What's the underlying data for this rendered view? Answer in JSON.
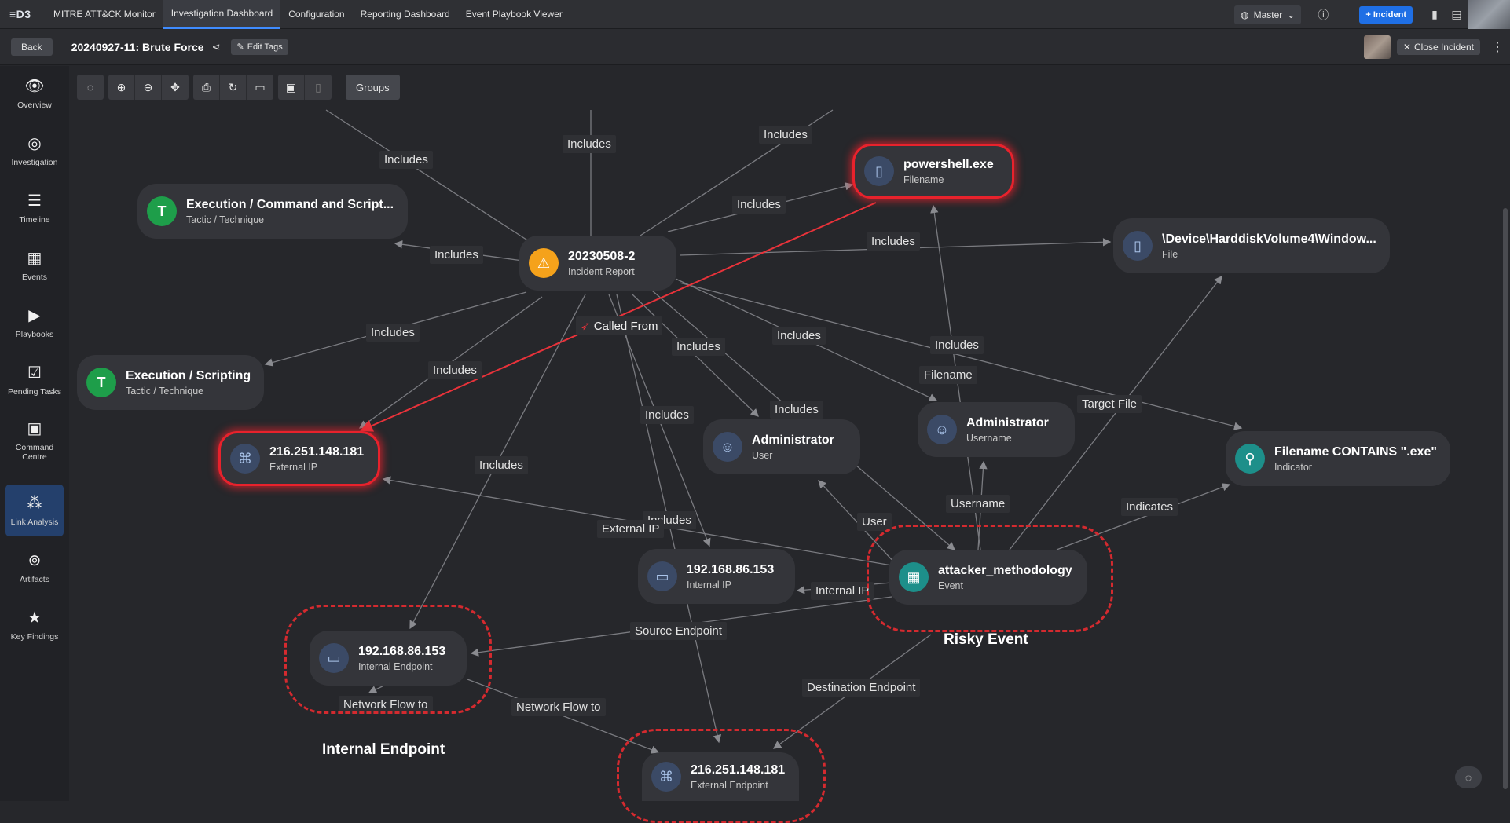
{
  "app": {
    "logo": "≡D3"
  },
  "topnav": {
    "tabs": [
      {
        "label": "MITRE ATT&CK Monitor"
      },
      {
        "label": "Investigation Dashboard"
      },
      {
        "label": "Configuration"
      },
      {
        "label": "Reporting Dashboard"
      },
      {
        "label": "Event Playbook Viewer"
      }
    ],
    "environment": "Master",
    "incident_button": "+ Incident"
  },
  "subbar": {
    "back": "Back",
    "title": "20240927-11: Brute Force",
    "edit_tags": "Edit Tags",
    "close_incident": "Close Incident"
  },
  "sidebar": {
    "items": [
      {
        "label": "Overview",
        "icon": "binoculars-icon"
      },
      {
        "label": "Investigation",
        "icon": "target-icon"
      },
      {
        "label": "Timeline",
        "icon": "timeline-icon"
      },
      {
        "label": "Events",
        "icon": "calendar-icon"
      },
      {
        "label": "Playbooks",
        "icon": "playbook-icon"
      },
      {
        "label": "Pending Tasks",
        "icon": "tasks-icon"
      },
      {
        "label": "Command Centre",
        "icon": "command-icon"
      },
      {
        "label": "Link Analysis",
        "icon": "link-analysis-icon"
      },
      {
        "label": "Artifacts",
        "icon": "fingerprint-icon"
      },
      {
        "label": "Key Findings",
        "icon": "star-icon"
      }
    ]
  },
  "toolbar": {
    "groups_label": "Groups"
  },
  "nodes": {
    "incident": {
      "name": "20230508-2",
      "type": "Incident Report"
    },
    "exec_cmd": {
      "name": "Execution / Command and Script...",
      "type": "Tactic / Technique"
    },
    "exec_script": {
      "name": "Execution / Scripting",
      "type": "Tactic / Technique"
    },
    "powershell": {
      "name": "powershell.exe",
      "type": "Filename"
    },
    "device_file": {
      "name": "\\Device\\HarddiskVolume4\\Window...",
      "type": "File"
    },
    "ext_ip": {
      "name": "216.251.148.181",
      "type": "External IP"
    },
    "admin_user": {
      "name": "Administrator",
      "type": "User"
    },
    "admin_username": {
      "name": "Administrator",
      "type": "Username"
    },
    "indicator": {
      "name": "Filename CONTAINS \".exe\"",
      "type": "Indicator"
    },
    "int_ip": {
      "name": "192.168.86.153",
      "type": "Internal IP"
    },
    "event": {
      "name": "attacker_methodology",
      "type": "Event"
    },
    "int_endpoint": {
      "name": "192.168.86.153",
      "type": "Internal Endpoint"
    },
    "ext_endpoint": {
      "name": "216.251.148.181",
      "type": "External Endpoint"
    }
  },
  "edge_labels": {
    "includes": "Includes",
    "called_from": "Called From",
    "filename": "Filename",
    "target_file": "Target File",
    "username": "Username",
    "user": "User",
    "external_ip": "External IP",
    "internal_ip": "Internal IP",
    "indicates": "Indicates",
    "source_endpoint": "Source Endpoint",
    "destination_endpoint": "Destination Endpoint",
    "network_flow_to": "Network Flow to"
  },
  "groups": {
    "risky_event": "Risky Event",
    "internal_endpoint": "Internal Endpoint"
  },
  "colors": {
    "accent": "#3f8cff",
    "highlight_red": "#e8222c",
    "tactic_green": "#1e9e4a",
    "incident_orange": "#f5a21b",
    "event_teal": "#1d8f8a"
  }
}
